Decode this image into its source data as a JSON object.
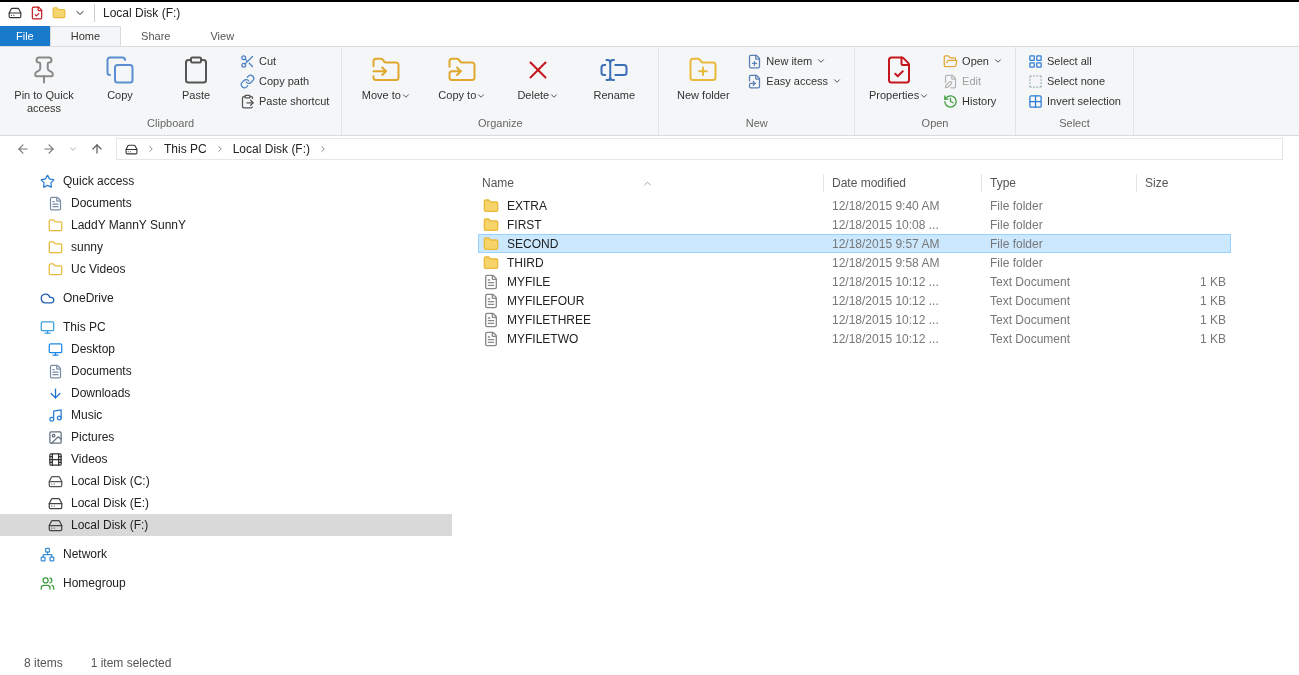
{
  "window": {
    "title": "Local Disk (F:)"
  },
  "tabs": [
    {
      "label": "File",
      "kind": "file",
      "selected": false
    },
    {
      "label": "Home",
      "kind": "tab",
      "selected": true
    },
    {
      "label": "Share",
      "kind": "tab",
      "selected": false
    },
    {
      "label": "View",
      "kind": "tab",
      "selected": false
    }
  ],
  "ribbon": [
    {
      "name": "Clipboard",
      "items": [
        {
          "label": "Pin to Quick access",
          "kind": "large",
          "dropdown": false,
          "disabled": false
        },
        {
          "label": "Copy",
          "kind": "large",
          "dropdown": false,
          "disabled": false
        },
        {
          "label": "Paste",
          "kind": "large",
          "dropdown": false,
          "disabled": false
        },
        {
          "label": "Cut",
          "kind": "small",
          "dropdown": false,
          "disabled": false
        },
        {
          "label": "Copy path",
          "kind": "small",
          "dropdown": false,
          "disabled": false
        },
        {
          "label": "Paste shortcut",
          "kind": "small",
          "dropdown": false,
          "disabled": false
        }
      ]
    },
    {
      "name": "Organize",
      "items": [
        {
          "label": "Move to",
          "kind": "large",
          "dropdown": true,
          "disabled": false
        },
        {
          "label": "Copy to",
          "kind": "large",
          "dropdown": true,
          "disabled": false
        },
        {
          "label": "Delete",
          "kind": "large",
          "dropdown": true,
          "disabled": false
        },
        {
          "label": "Rename",
          "kind": "large",
          "dropdown": false,
          "disabled": false
        }
      ]
    },
    {
      "name": "New",
      "items": [
        {
          "label": "New folder",
          "kind": "large",
          "dropdown": false,
          "disabled": false
        },
        {
          "label": "New item",
          "kind": "small",
          "dropdown": true,
          "disabled": false
        },
        {
          "label": "Easy access",
          "kind": "small",
          "dropdown": true,
          "disabled": false
        }
      ]
    },
    {
      "name": "Open",
      "items": [
        {
          "label": "Properties",
          "kind": "large",
          "dropdown": true,
          "disabled": false
        },
        {
          "label": "Open",
          "kind": "small",
          "dropdown": true,
          "disabled": false
        },
        {
          "label": "Edit",
          "kind": "small",
          "dropdown": false,
          "disabled": true
        },
        {
          "label": "History",
          "kind": "small",
          "dropdown": false,
          "disabled": false
        }
      ]
    },
    {
      "name": "Select",
      "items": [
        {
          "label": "Select all",
          "kind": "small",
          "dropdown": false,
          "disabled": false
        },
        {
          "label": "Select none",
          "kind": "small",
          "dropdown": false,
          "disabled": false
        },
        {
          "label": "Invert selection",
          "kind": "small",
          "dropdown": false,
          "disabled": false
        }
      ]
    }
  ],
  "address": {
    "path": [
      "This PC",
      "Local Disk (F:)"
    ]
  },
  "navigation": [
    {
      "label": "Quick access",
      "selected": false,
      "children": [
        {
          "label": "Documents",
          "selected": false
        },
        {
          "label": "LaddY MannY SunnY",
          "selected": false
        },
        {
          "label": "sunny",
          "selected": false
        },
        {
          "label": "Uc Videos",
          "selected": false
        }
      ]
    },
    {
      "label": "OneDrive",
      "selected": false
    },
    {
      "label": "This PC",
      "selected": false,
      "children": [
        {
          "label": "Desktop",
          "selected": false
        },
        {
          "label": "Documents",
          "selected": false
        },
        {
          "label": "Downloads",
          "selected": false
        },
        {
          "label": "Music",
          "selected": false
        },
        {
          "label": "Pictures",
          "selected": false
        },
        {
          "label": "Videos",
          "selected": false
        },
        {
          "label": "Local Disk (C:)",
          "selected": false
        },
        {
          "label": "Local Disk (E:)",
          "selected": false
        },
        {
          "label": "Local Disk (F:)",
          "selected": true
        }
      ]
    },
    {
      "label": "Network",
      "selected": false
    },
    {
      "label": "Homegroup",
      "selected": false
    }
  ],
  "table": {
    "columns": [
      "Name",
      "Date modified",
      "Type",
      "Size"
    ],
    "rows": [
      {
        "kind": "folder",
        "name": "EXTRA",
        "date": "12/18/2015 9:40 AM",
        "type": "File folder",
        "size": "",
        "selected": false
      },
      {
        "kind": "folder",
        "name": "FIRST",
        "date": "12/18/2015 10:08 ...",
        "type": "File folder",
        "size": "",
        "selected": false
      },
      {
        "kind": "folder",
        "name": "SECOND",
        "date": "12/18/2015 9:57 AM",
        "type": "File folder",
        "size": "",
        "selected": true
      },
      {
        "kind": "folder",
        "name": "THIRD",
        "date": "12/18/2015 9:58 AM",
        "type": "File folder",
        "size": "",
        "selected": false
      },
      {
        "kind": "file",
        "name": "MYFILE",
        "date": "12/18/2015 10:12 ...",
        "type": "Text Document",
        "size": "1 KB",
        "selected": false
      },
      {
        "kind": "file",
        "name": "MYFILEFOUR",
        "date": "12/18/2015 10:12 ...",
        "type": "Text Document",
        "size": "1 KB",
        "selected": false
      },
      {
        "kind": "file",
        "name": "MYFILETHREE",
        "date": "12/18/2015 10:12 ...",
        "type": "Text Document",
        "size": "1 KB",
        "selected": false
      },
      {
        "kind": "file",
        "name": "MYFILETWO",
        "date": "12/18/2015 10:12 ...",
        "type": "Text Document",
        "size": "1 KB",
        "selected": false
      }
    ]
  },
  "status_bar": {
    "count": "8 items",
    "selection": "1 item selected"
  }
}
